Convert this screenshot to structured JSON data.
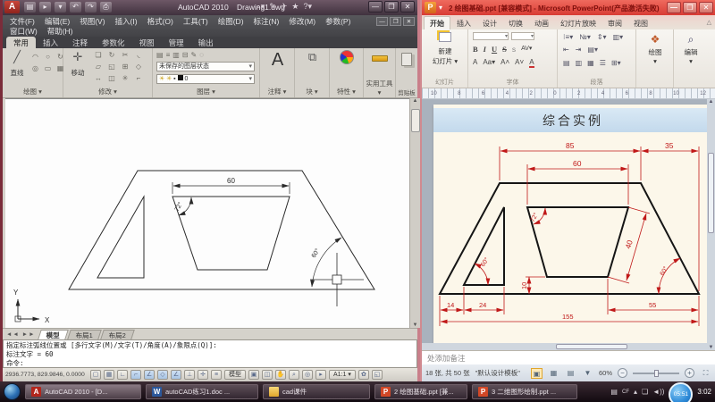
{
  "acad": {
    "title_app": "AutoCAD 2010",
    "title_doc": "Drawing1.dwg",
    "menus": [
      "文件(F)",
      "编辑(E)",
      "视图(V)",
      "插入(I)",
      "格式(O)",
      "工具(T)",
      "绘图(D)",
      "标注(N)",
      "修改(M)",
      "参数(P)"
    ],
    "menus2": [
      "窗口(W)",
      "帮助(H)"
    ],
    "tabs": [
      "常用",
      "插入",
      "注释",
      "参数化",
      "视图",
      "管理",
      "输出"
    ],
    "panels": {
      "draw_label": "绘图",
      "line_btn": "直线",
      "modify_label": "修改",
      "move_btn": "移动",
      "layers_label": "图层",
      "layer_state": "未保存的图层状态",
      "layer_current": "0",
      "annotate_label": "注释",
      "annotate_big": "A",
      "block_label": "块",
      "props_label": "特性",
      "utils_label": "实用工具",
      "clipboard_label": "剪贴板"
    },
    "canvas": {
      "dim_60": "60",
      "angle_72": "72°",
      "angle_60": "60°",
      "axis_x": "X",
      "axis_y": "Y"
    },
    "layout_tabs": [
      "模型",
      "布局1",
      "布局2"
    ],
    "cmd": [
      "指定标注弧线位置或 [多行文字(M)/文字(T)/角度(A)/象限点(Q)]:",
      "标注文字 = 60",
      "命令:"
    ],
    "status": {
      "coords": "2936.7773, 829.9846, 0.0000",
      "model": "模型",
      "scale": "1:1"
    }
  },
  "ppt": {
    "title": "2 绘图基础.ppt [兼容模式] - Microsoft PowerPoint(产品激活失败)",
    "tabs": [
      "开始",
      "插入",
      "设计",
      "切换",
      "动画",
      "幻灯片放映",
      "审阅",
      "视图"
    ],
    "ribbon": {
      "new_slide_l1": "新建",
      "new_slide_l2": "幻灯片",
      "slides_group": "幻灯片",
      "font_group": "字体",
      "para_group": "段落",
      "draw_group": "绘图",
      "edit_group": "编辑",
      "bold": "B",
      "italic": "I",
      "underline": "U",
      "strike": "S"
    },
    "ruler": [
      "10",
      "8",
      "6",
      "4",
      "2",
      "0",
      "2",
      "4",
      "6",
      "8",
      "10",
      "12"
    ],
    "slide": {
      "title": "综合实例",
      "d85": "85",
      "d35": "35",
      "d60": "60",
      "a72": "72°",
      "d40": "40",
      "a60l": "60°",
      "a60r": "60°",
      "d10": "10",
      "d14": "14",
      "d24": "24",
      "d55": "55",
      "d155": "155"
    },
    "notes": "处添加备注",
    "status": {
      "slides": "18 张, 共 50 张",
      "template": "\"默认设计模板\"",
      "zoom": "60%"
    }
  },
  "taskbar": {
    "acad": "AutoCAD 2010 - [D...",
    "word": "autoCAD练习1.doc ...",
    "folder": "cad课件",
    "ppt1": "2 绘图基础.ppt [兼...",
    "ppt2": "3 二维图形绘制.ppt ...",
    "recorder": "05:51",
    "clock": "3:02"
  },
  "colors": {
    "dim_red": "#c01818",
    "ppt_title_red": "#e04848",
    "slide_cream": "#fcf7ea",
    "slide_band_blue": "#cfe2f1",
    "acad_panel": "#d5d2cb"
  }
}
